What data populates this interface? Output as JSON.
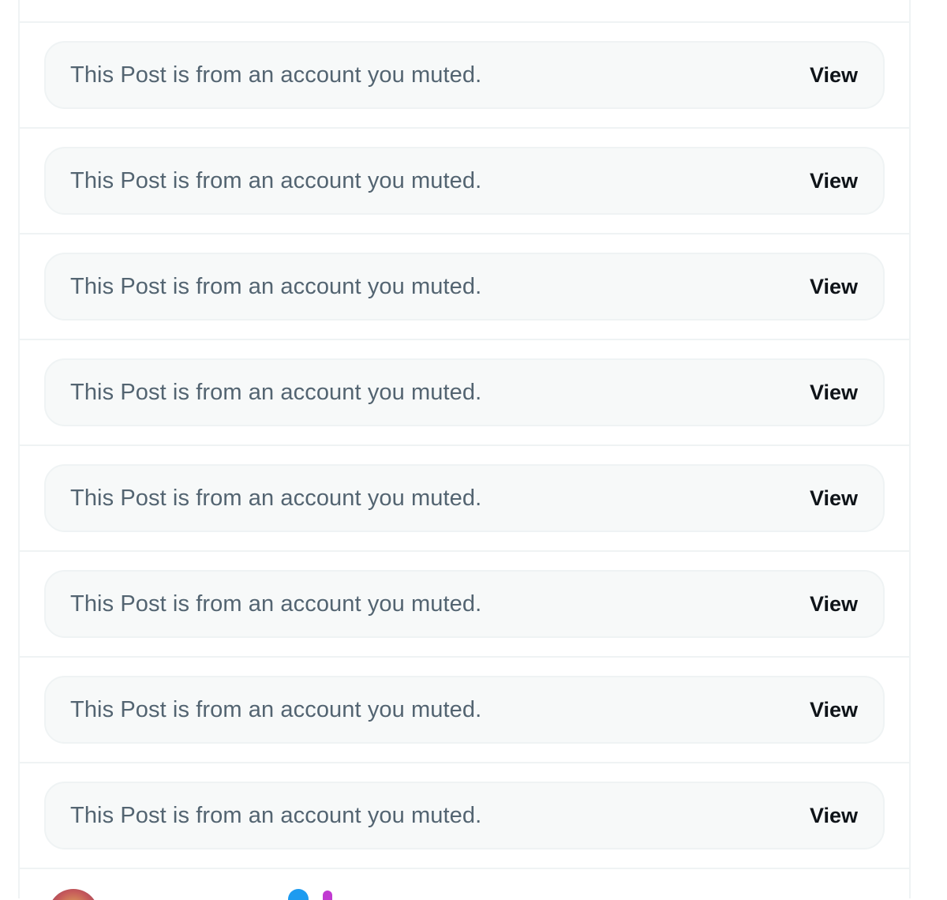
{
  "muted_posts": [
    {
      "message": "This Post is from an account you muted.",
      "action_label": "View"
    },
    {
      "message": "This Post is from an account you muted.",
      "action_label": "View"
    },
    {
      "message": "This Post is from an account you muted.",
      "action_label": "View"
    },
    {
      "message": "This Post is from an account you muted.",
      "action_label": "View"
    },
    {
      "message": "This Post is from an account you muted.",
      "action_label": "View"
    },
    {
      "message": "This Post is from an account you muted.",
      "action_label": "View"
    },
    {
      "message": "This Post is from an account you muted.",
      "action_label": "View"
    },
    {
      "message": "This Post is from an account you muted.",
      "action_label": "View"
    }
  ],
  "next_post": {
    "author_name": "",
    "author_handle": "",
    "verified_icon": "verified-badge-icon",
    "emoji_icon": "emoji-icon"
  },
  "colors": {
    "muted_text": "#536471",
    "view_text": "#0f1419",
    "box_bg": "#f7f9f9",
    "divider": "#eff3f4",
    "verified": "#1d9bf0"
  }
}
